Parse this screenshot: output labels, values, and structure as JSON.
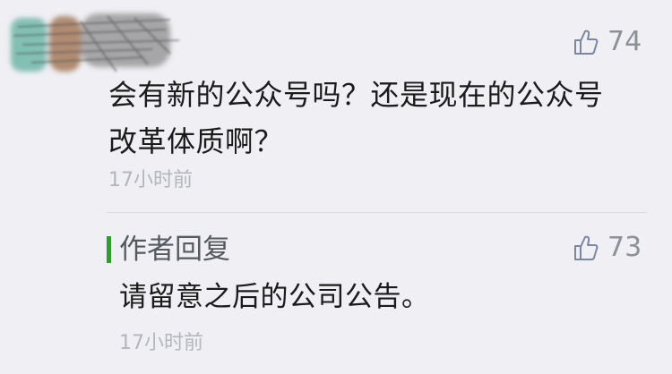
{
  "comment": {
    "text_line1": "会有新的公众号吗？还是现在的公众号",
    "text_line2": "改革体质啊？",
    "time": "17小时前",
    "likes": "74"
  },
  "reply": {
    "label": "作者回复",
    "text": "请留意之后的公司公告。",
    "time": "17小时前",
    "likes": "73"
  },
  "colors": {
    "background": "#efeff4",
    "accent_bar": "#1aad19",
    "icon": "#8a8f99",
    "timestamp": "#b3b6bc"
  },
  "icons": {
    "like": "thumbs-up-icon"
  }
}
